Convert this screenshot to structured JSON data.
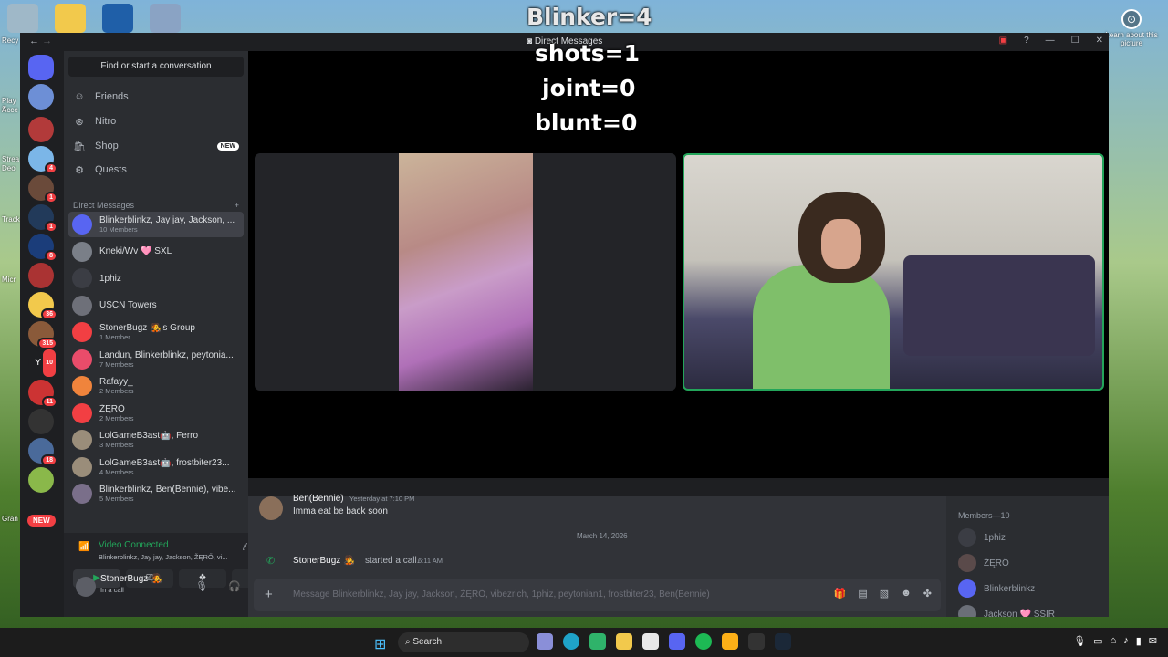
{
  "window": {
    "title": "Direct Messages",
    "nav_back": "←",
    "nav_forward": "→"
  },
  "desktop": {
    "learn_about": "Learn about this picture",
    "left_labels": [
      "Recy",
      "Play S",
      "Acce",
      "Strea",
      "Deo",
      "Track",
      "Micr",
      "Gran"
    ]
  },
  "overlay": {
    "line1": "Blinker=4",
    "line2": "shots=1",
    "line3": "joint=0",
    "line4": "blunt=0"
  },
  "servers": {
    "badges": [
      "",
      "",
      "",
      "4",
      "1",
      "1",
      "8",
      "",
      "36",
      "315",
      "10",
      "11",
      "",
      "18",
      ""
    ],
    "text_icon": "YS",
    "new_pill": "NEW"
  },
  "sidebar": {
    "search_placeholder": "Find or start a conversation",
    "nav": [
      {
        "label": "Friends",
        "icon": "☺"
      },
      {
        "label": "Nitro",
        "icon": "⊛"
      },
      {
        "label": "Shop",
        "icon": "🛍",
        "badge": "NEW"
      },
      {
        "label": "Quests",
        "icon": "⚙"
      }
    ],
    "dm_header": "Direct Messages",
    "dm_add": "+",
    "dms": [
      {
        "name": "Blinkerblinkz, Jay jay, Jackson, ...",
        "sub": "10 Members",
        "color": "#5865f2"
      },
      {
        "name": "Kneki/Wv 🩷 SXL",
        "sub": "",
        "color": "#7a7f88"
      },
      {
        "name": "1phiz",
        "sub": "",
        "color": "#3b3d44"
      },
      {
        "name": "USCN Towers",
        "sub": "",
        "color": "#6e7079"
      },
      {
        "name": "StonerBugz 🧑‍🎤's Group",
        "sub": "1 Member",
        "color": "#f23f43"
      },
      {
        "name": "Landun, Blinkerblinkz, peytonia...",
        "sub": "7 Members",
        "color": "#e94c6a"
      },
      {
        "name": "Rafayy_",
        "sub": "2 Members",
        "color": "#f0843c"
      },
      {
        "name": "ŽĘRŐ",
        "sub": "2 Members",
        "color": "#f23f43"
      },
      {
        "name": "LolGameB3ast🤖, Ferro",
        "sub": "3 Members",
        "color": "#9a8d7a"
      },
      {
        "name": "LolGameB3ast🤖, frostbiter23...",
        "sub": "4 Members",
        "color": "#9a8d7a"
      },
      {
        "name": "Blinkerblinkz, Ben(Bennie), vibe...",
        "sub": "5 Members",
        "color": "#7a6f8a"
      }
    ]
  },
  "voice": {
    "status": "Video Connected",
    "channel": "Blinkerblinkz, Jay jay, Jackson, ŽĘRŐ, vi...",
    "buttons": [
      "▶",
      "⎚",
      "❖",
      "✺"
    ]
  },
  "user": {
    "name": "StonerBugz 🧑‍🎤",
    "status": "In a call"
  },
  "chat": {
    "last_author": "Ben(Bennie)",
    "last_time": "Yesterday at 7:10 PM",
    "last_text": "Imma eat be back soon",
    "date_divider": "March 14, 2026",
    "call_author": "StonerBugz 🧑‍🎤",
    "call_text": "started a call.",
    "call_time": "6:11 AM",
    "input_placeholder": "Message Blinkerblinkz, Jay jay, Jackson, ŽĘRŐ, vibezrich, 1phiz, peytonian1, frostbiter23, Ben(Bennie)"
  },
  "members": {
    "header": "Members—10",
    "list": [
      {
        "name": "1phiz",
        "color": "#3b3d44"
      },
      {
        "name": "ŽĘRŐ",
        "color": "#5a4a4a"
      },
      {
        "name": "Blinkerblinkz",
        "color": "#5865f2"
      },
      {
        "name": "Jackson 🩷 SSIR",
        "color": "#6b6f78"
      }
    ]
  },
  "taskbar": {
    "search_label": "Search"
  }
}
